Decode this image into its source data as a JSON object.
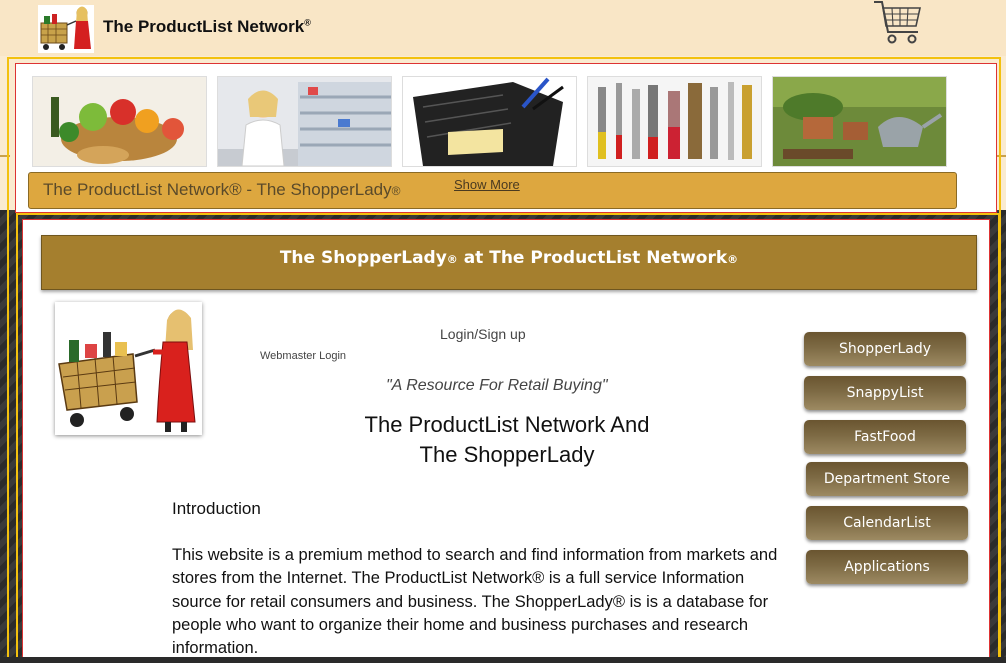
{
  "header": {
    "site_title": "The ProductList Network",
    "registered_mark": "®"
  },
  "gallery": {
    "images": [
      {
        "icon": "produce-basket-image"
      },
      {
        "icon": "pharmacy-clerk-image"
      },
      {
        "icon": "desk-organizer-image"
      },
      {
        "icon": "hand-tools-image"
      },
      {
        "icon": "garden-tools-image"
      }
    ]
  },
  "banner": {
    "text": "The ProductList Network® - The ShopperLady",
    "registered_mark": "®",
    "show_more": "Show More"
  },
  "content": {
    "header_title_part1": "The ShopperLady",
    "header_mark1": "®",
    "header_title_part2": " at The ProductList Network",
    "header_mark2": "®",
    "login": "Login/Sign up",
    "webmaster_login": "Webmaster Login",
    "tagline": "\"A Resource For Retail Buying\"",
    "heading_line1": "The ProductList Network And",
    "heading_line2": "The ShopperLady",
    "intro_heading": "Introduction",
    "intro_line1": "This website is a premium method to search and find information from markets and",
    "intro_line2": "stores from the Internet.  The ProductList Network® is a full service Information",
    "intro_line3": "source for retail consumers and business. The ShopperLady® is is a database for",
    "intro_line4": "people who want to organize their home and business purchases and research",
    "intro_line5": "information."
  },
  "nav": {
    "shopperlady": "ShopperLady",
    "snappylist": "SnappyList",
    "fastfood": "FastFood",
    "department_store": "Department Store",
    "calendarlist": "CalendarList",
    "applications": "Applications"
  },
  "colors": {
    "banner": "#dda73f",
    "header_band": "#a57f2e",
    "frame": "#f3c10e",
    "button": "#7d6a44"
  }
}
